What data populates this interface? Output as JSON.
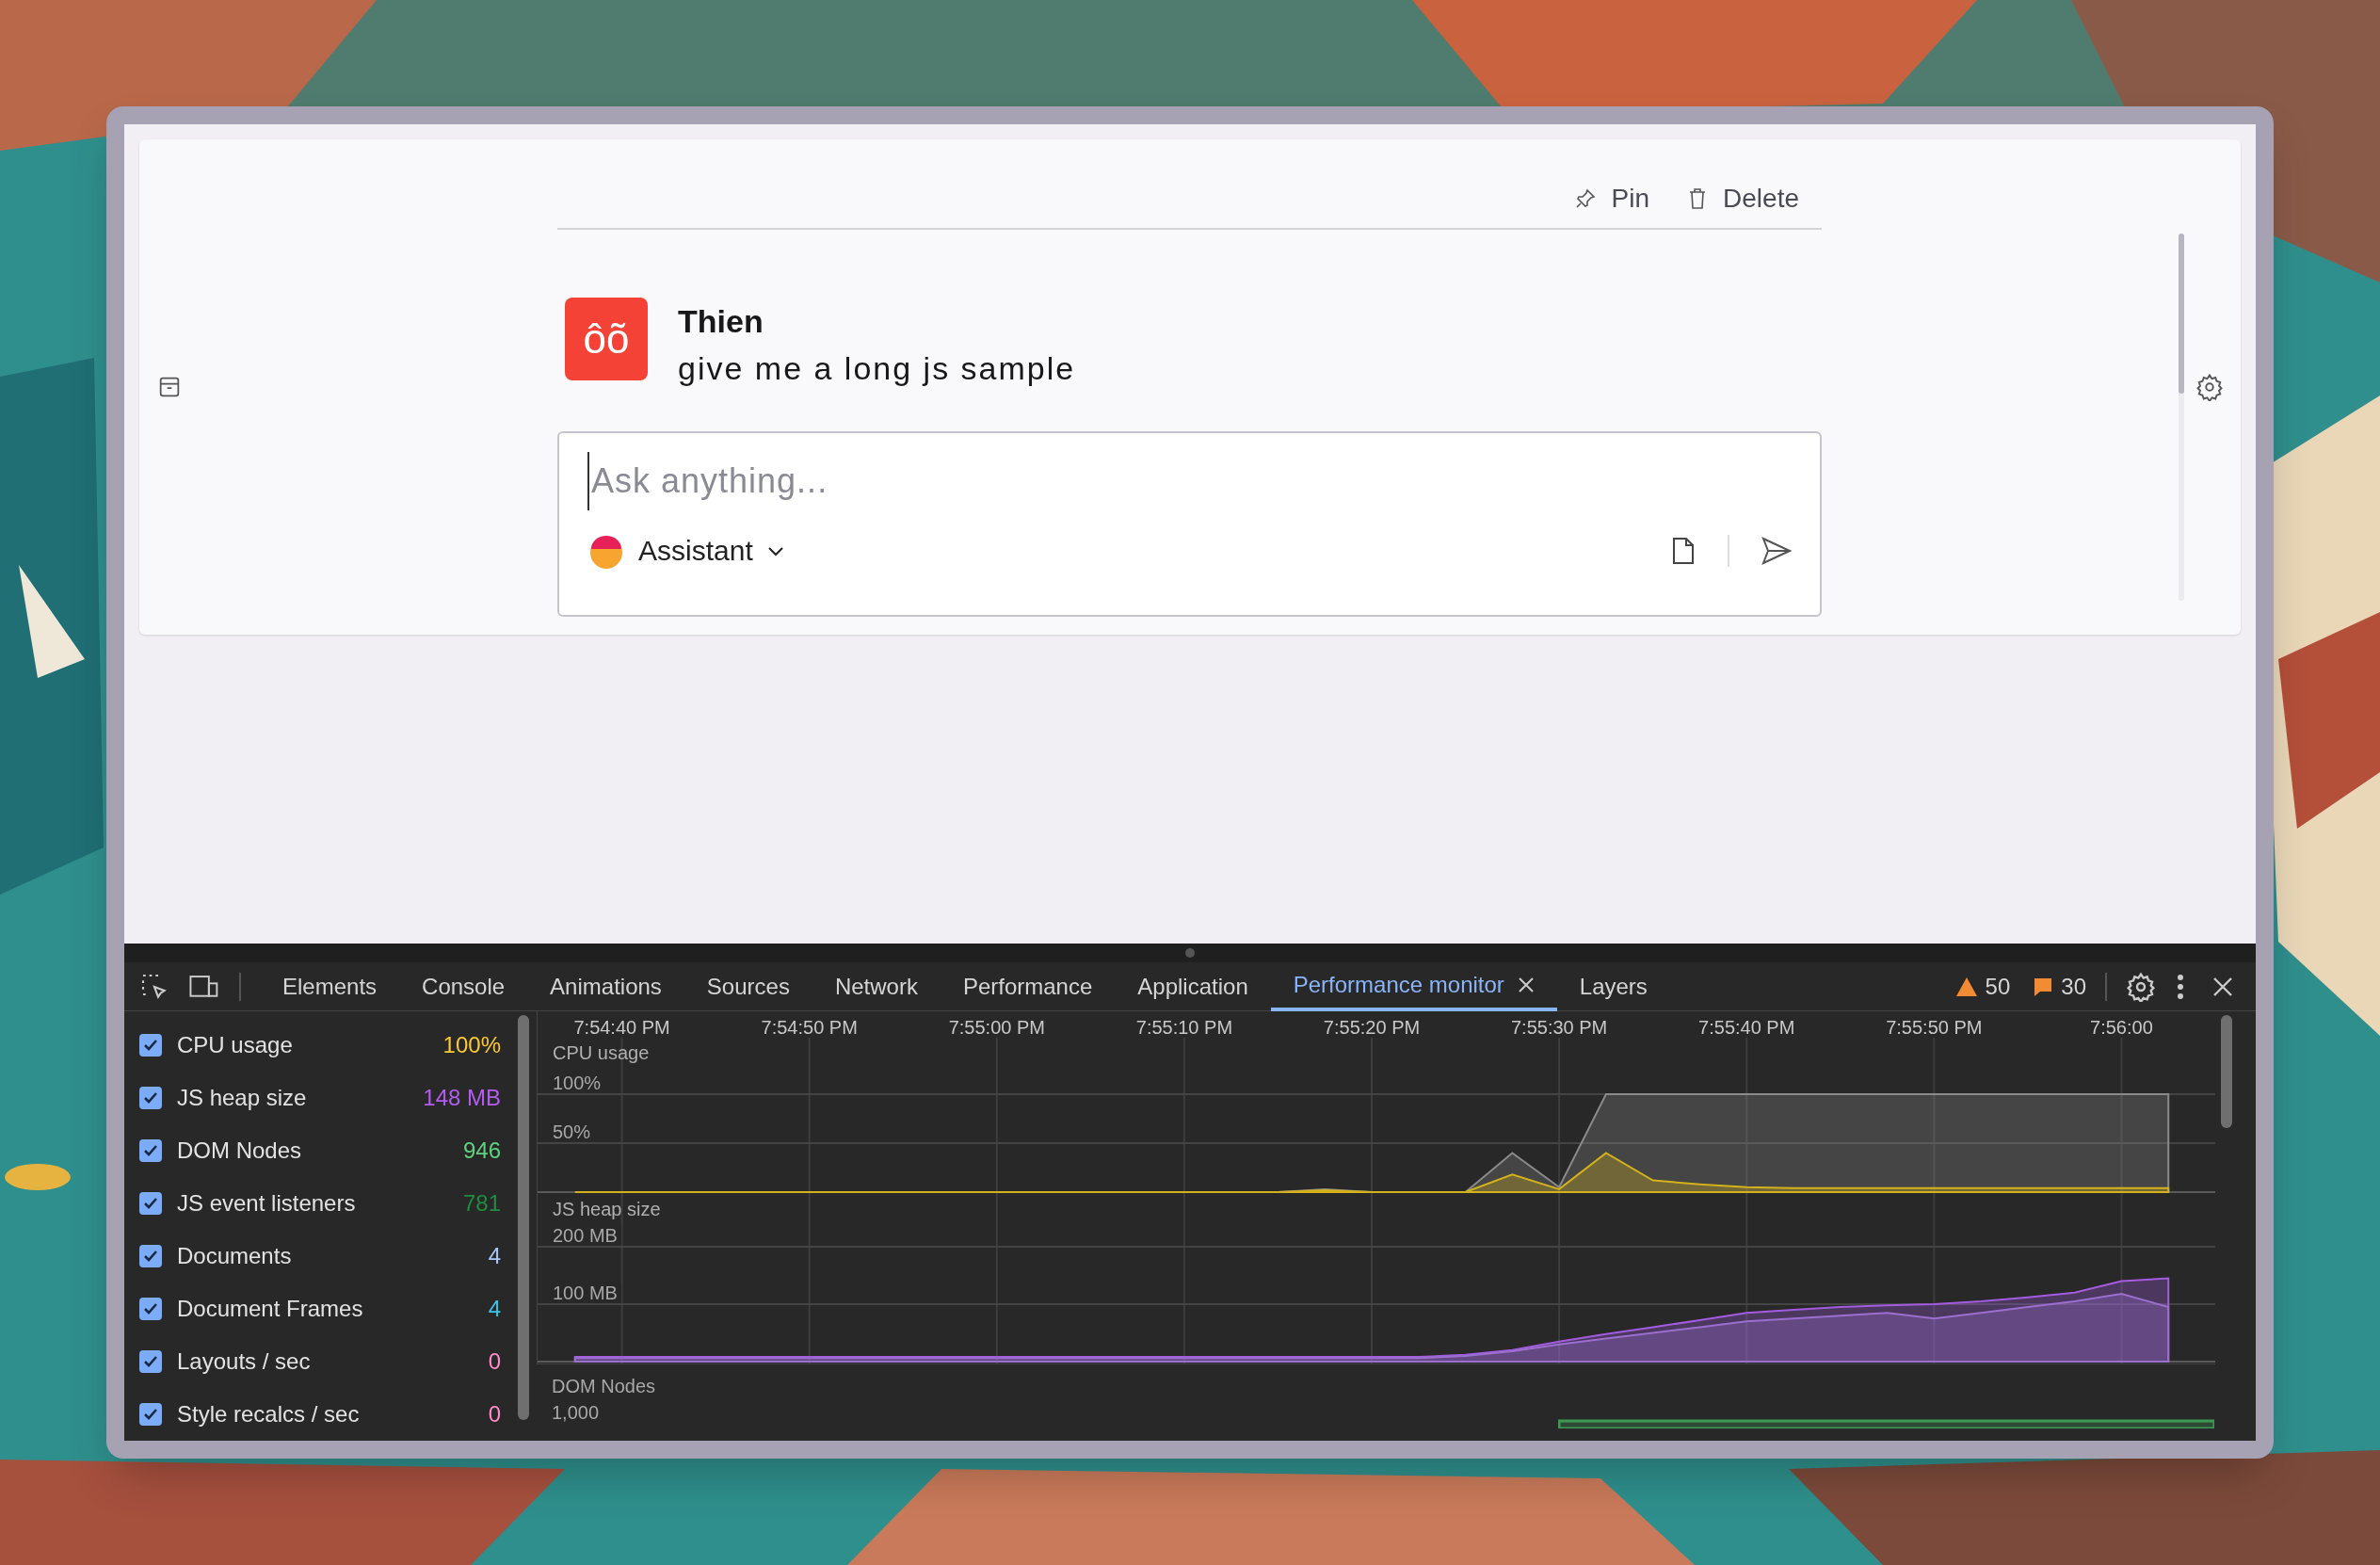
{
  "chat": {
    "actions": [
      {
        "label": "Pin",
        "kind": "pin"
      },
      {
        "label": "Delete",
        "kind": "delete"
      }
    ],
    "message": {
      "avatar": "ôõ",
      "author": "Thien",
      "text": "give me a long js sample"
    },
    "composer": {
      "placeholder": "Ask anything...",
      "assistant": "Assistant"
    }
  },
  "devtools": {
    "tabs": [
      {
        "label": "Elements",
        "selected": false,
        "closable": false
      },
      {
        "label": "Console",
        "selected": false,
        "closable": false
      },
      {
        "label": "Animations",
        "selected": false,
        "closable": false
      },
      {
        "label": "Sources",
        "selected": false,
        "closable": false
      },
      {
        "label": "Network",
        "selected": false,
        "closable": false
      },
      {
        "label": "Performance",
        "selected": false,
        "closable": false
      },
      {
        "label": "Application",
        "selected": false,
        "closable": false
      },
      {
        "label": "Performance monitor",
        "selected": true,
        "closable": true
      },
      {
        "label": "Layers",
        "selected": false,
        "closable": false
      }
    ],
    "warnings": "50",
    "errors": "30",
    "metrics": [
      {
        "name": "CPU usage",
        "value": "100%",
        "color": "#fcc934",
        "checked": true
      },
      {
        "name": "JS heap size",
        "value": "148 MB",
        "color": "#b45cf0",
        "checked": true
      },
      {
        "name": "DOM Nodes",
        "value": "946",
        "color": "#5fd27f",
        "checked": true
      },
      {
        "name": "JS event listeners",
        "value": "781",
        "color": "#1e8e3e",
        "checked": true
      },
      {
        "name": "Documents",
        "value": "4",
        "color": "#a8c7fa",
        "checked": true
      },
      {
        "name": "Document Frames",
        "value": "4",
        "color": "#3cc4e6",
        "checked": true
      },
      {
        "name": "Layouts / sec",
        "value": "0",
        "color": "#ff8bcb",
        "checked": true
      },
      {
        "name": "Style recalcs / sec",
        "value": "0",
        "color": "#ff8bcb",
        "checked": true
      }
    ],
    "cpu_panel": {
      "chart_data": {
        "type": "area",
        "title": "CPU usage",
        "ylim": [
          0,
          184.6
        ],
        "grid": true,
        "categories": [
          null,
          "7:54:40 PM",
          null,
          null,
          null,
          "7:54:50 PM",
          null,
          null,
          null,
          "7:55:00 PM",
          null,
          null,
          null,
          "7:55:10 PM",
          null,
          null,
          null,
          "7:55:20 PM",
          null,
          null,
          null,
          "7:55:30 PM",
          null,
          null,
          null,
          "7:55:40 PM",
          null,
          null,
          null,
          "7:55:50 PM",
          null,
          null,
          null,
          "7:56:00",
          null
        ],
        "yticks": [
          {
            "value": 100,
            "label": "100%"
          },
          {
            "value": 50,
            "label": "50%"
          }
        ],
        "series": [
          {
            "color": "#8a8a8a",
            "values": [
              0,
              0,
              0,
              0,
              0,
              0,
              0,
              0,
              0,
              0,
              0,
              0,
              0,
              0,
              0,
              0,
              3,
              0,
              0,
              0,
              40,
              5,
              100,
              100,
              100,
              100,
              100,
              100,
              100,
              100,
              100,
              100,
              100,
              100,
              100
            ]
          },
          {
            "color": "#d4b21c",
            "values": [
              0,
              0,
              0,
              0,
              0,
              0,
              0,
              0,
              0,
              0,
              0,
              0,
              0,
              0,
              0,
              0,
              2,
              0,
              0,
              0,
              18,
              3,
              40,
              12,
              8,
              5,
              4,
              4,
              4,
              4,
              4,
              4,
              4,
              4,
              4
            ]
          }
        ]
      }
    },
    "heap_panel": {
      "chart_data": {
        "type": "area",
        "title": "JS heap size",
        "ylim": [
          0,
          292
        ],
        "grid": true,
        "categories": [
          null,
          null,
          null,
          null,
          null,
          null,
          null,
          null,
          null,
          null,
          null,
          null,
          null,
          null,
          null,
          null,
          null,
          null,
          null,
          null,
          null,
          null,
          null,
          null,
          null,
          null,
          null,
          null,
          null,
          null,
          null,
          null,
          null,
          null,
          null
        ],
        "yticks": [
          {
            "value": 200,
            "label": "200 MB"
          },
          {
            "value": 100,
            "label": "100 MB"
          }
        ],
        "series": [
          {
            "color": "#a35ce0",
            "values": [
              8,
              8,
              8,
              8,
              8,
              8,
              8,
              8,
              8,
              8,
              8,
              8,
              8,
              8,
              8,
              8,
              8,
              8,
              8,
              12,
              20,
              35,
              48,
              60,
              72,
              85,
              90,
              95,
              98,
              100,
              105,
              112,
              120,
              140,
              145
            ]
          },
          {
            "color": "#9b6fd0",
            "values": [
              6,
              6,
              6,
              6,
              6,
              6,
              6,
              6,
              6,
              6,
              6,
              6,
              6,
              6,
              6,
              6,
              6,
              6,
              6,
              10,
              18,
              30,
              40,
              50,
              60,
              70,
              75,
              80,
              85,
              75,
              85,
              95,
              105,
              118,
              95
            ]
          }
        ]
      }
    },
    "dom_panel": {
      "title": "DOM Nodes",
      "tick": "1,000"
    }
  }
}
